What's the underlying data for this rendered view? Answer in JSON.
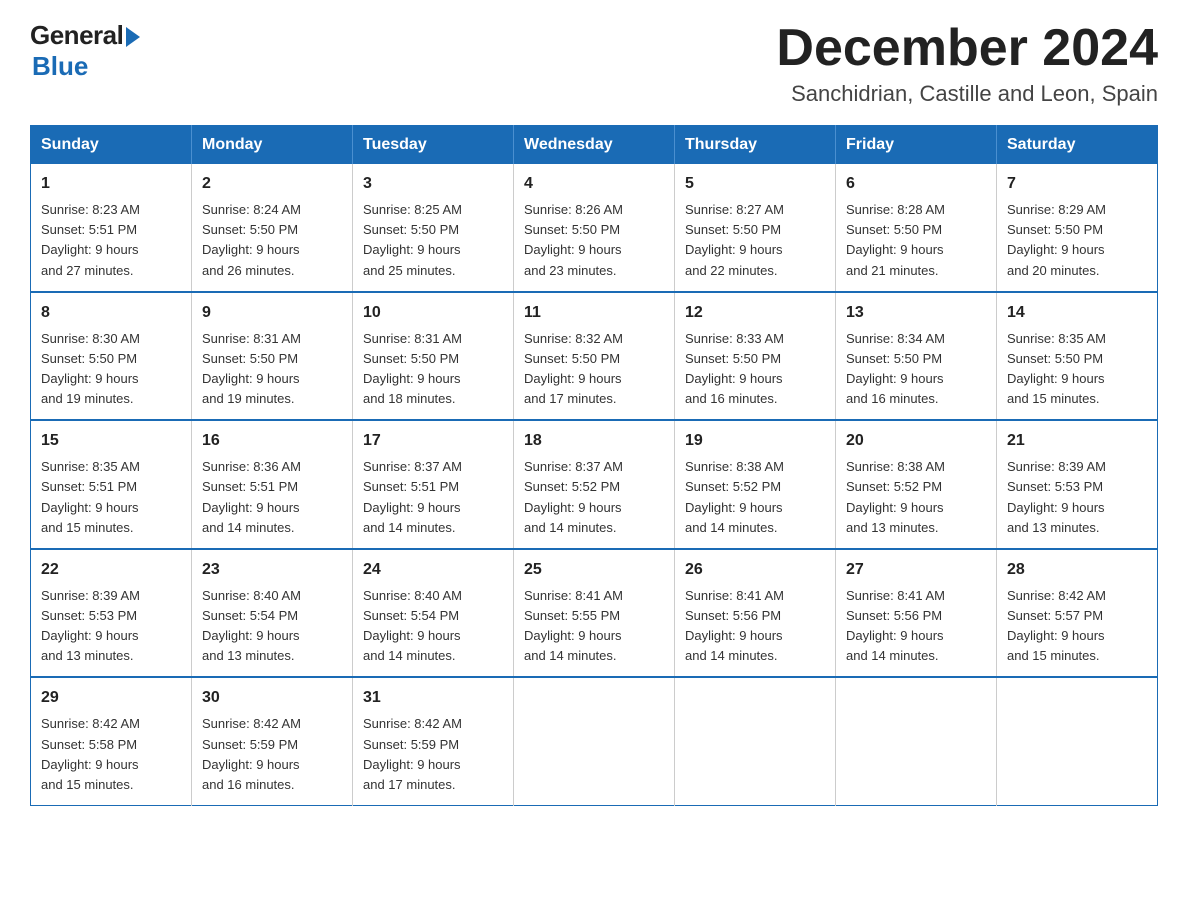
{
  "logo": {
    "general": "General",
    "blue": "Blue"
  },
  "title": "December 2024",
  "location": "Sanchidrian, Castille and Leon, Spain",
  "days_of_week": [
    "Sunday",
    "Monday",
    "Tuesday",
    "Wednesday",
    "Thursday",
    "Friday",
    "Saturday"
  ],
  "weeks": [
    [
      {
        "day": "1",
        "sunrise": "8:23 AM",
        "sunset": "5:51 PM",
        "daylight": "9 hours and 27 minutes."
      },
      {
        "day": "2",
        "sunrise": "8:24 AM",
        "sunset": "5:50 PM",
        "daylight": "9 hours and 26 minutes."
      },
      {
        "day": "3",
        "sunrise": "8:25 AM",
        "sunset": "5:50 PM",
        "daylight": "9 hours and 25 minutes."
      },
      {
        "day": "4",
        "sunrise": "8:26 AM",
        "sunset": "5:50 PM",
        "daylight": "9 hours and 23 minutes."
      },
      {
        "day": "5",
        "sunrise": "8:27 AM",
        "sunset": "5:50 PM",
        "daylight": "9 hours and 22 minutes."
      },
      {
        "day": "6",
        "sunrise": "8:28 AM",
        "sunset": "5:50 PM",
        "daylight": "9 hours and 21 minutes."
      },
      {
        "day": "7",
        "sunrise": "8:29 AM",
        "sunset": "5:50 PM",
        "daylight": "9 hours and 20 minutes."
      }
    ],
    [
      {
        "day": "8",
        "sunrise": "8:30 AM",
        "sunset": "5:50 PM",
        "daylight": "9 hours and 19 minutes."
      },
      {
        "day": "9",
        "sunrise": "8:31 AM",
        "sunset": "5:50 PM",
        "daylight": "9 hours and 19 minutes."
      },
      {
        "day": "10",
        "sunrise": "8:31 AM",
        "sunset": "5:50 PM",
        "daylight": "9 hours and 18 minutes."
      },
      {
        "day": "11",
        "sunrise": "8:32 AM",
        "sunset": "5:50 PM",
        "daylight": "9 hours and 17 minutes."
      },
      {
        "day": "12",
        "sunrise": "8:33 AM",
        "sunset": "5:50 PM",
        "daylight": "9 hours and 16 minutes."
      },
      {
        "day": "13",
        "sunrise": "8:34 AM",
        "sunset": "5:50 PM",
        "daylight": "9 hours and 16 minutes."
      },
      {
        "day": "14",
        "sunrise": "8:35 AM",
        "sunset": "5:50 PM",
        "daylight": "9 hours and 15 minutes."
      }
    ],
    [
      {
        "day": "15",
        "sunrise": "8:35 AM",
        "sunset": "5:51 PM",
        "daylight": "9 hours and 15 minutes."
      },
      {
        "day": "16",
        "sunrise": "8:36 AM",
        "sunset": "5:51 PM",
        "daylight": "9 hours and 14 minutes."
      },
      {
        "day": "17",
        "sunrise": "8:37 AM",
        "sunset": "5:51 PM",
        "daylight": "9 hours and 14 minutes."
      },
      {
        "day": "18",
        "sunrise": "8:37 AM",
        "sunset": "5:52 PM",
        "daylight": "9 hours and 14 minutes."
      },
      {
        "day": "19",
        "sunrise": "8:38 AM",
        "sunset": "5:52 PM",
        "daylight": "9 hours and 14 minutes."
      },
      {
        "day": "20",
        "sunrise": "8:38 AM",
        "sunset": "5:52 PM",
        "daylight": "9 hours and 13 minutes."
      },
      {
        "day": "21",
        "sunrise": "8:39 AM",
        "sunset": "5:53 PM",
        "daylight": "9 hours and 13 minutes."
      }
    ],
    [
      {
        "day": "22",
        "sunrise": "8:39 AM",
        "sunset": "5:53 PM",
        "daylight": "9 hours and 13 minutes."
      },
      {
        "day": "23",
        "sunrise": "8:40 AM",
        "sunset": "5:54 PM",
        "daylight": "9 hours and 13 minutes."
      },
      {
        "day": "24",
        "sunrise": "8:40 AM",
        "sunset": "5:54 PM",
        "daylight": "9 hours and 14 minutes."
      },
      {
        "day": "25",
        "sunrise": "8:41 AM",
        "sunset": "5:55 PM",
        "daylight": "9 hours and 14 minutes."
      },
      {
        "day": "26",
        "sunrise": "8:41 AM",
        "sunset": "5:56 PM",
        "daylight": "9 hours and 14 minutes."
      },
      {
        "day": "27",
        "sunrise": "8:41 AM",
        "sunset": "5:56 PM",
        "daylight": "9 hours and 14 minutes."
      },
      {
        "day": "28",
        "sunrise": "8:42 AM",
        "sunset": "5:57 PM",
        "daylight": "9 hours and 15 minutes."
      }
    ],
    [
      {
        "day": "29",
        "sunrise": "8:42 AM",
        "sunset": "5:58 PM",
        "daylight": "9 hours and 15 minutes."
      },
      {
        "day": "30",
        "sunrise": "8:42 AM",
        "sunset": "5:59 PM",
        "daylight": "9 hours and 16 minutes."
      },
      {
        "day": "31",
        "sunrise": "8:42 AM",
        "sunset": "5:59 PM",
        "daylight": "9 hours and 17 minutes."
      },
      null,
      null,
      null,
      null
    ]
  ],
  "labels": {
    "sunrise": "Sunrise:",
    "sunset": "Sunset:",
    "daylight": "Daylight:"
  }
}
